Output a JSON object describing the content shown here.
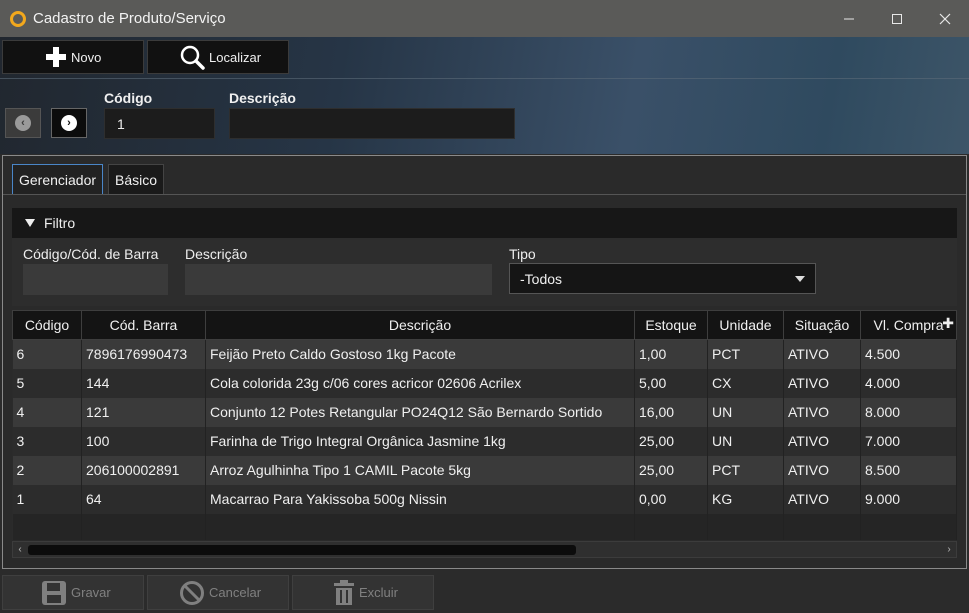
{
  "window": {
    "title": "Cadastro de Produto/Serviço",
    "minimize_icon": "minimize-icon",
    "maximize_icon": "maximize-icon",
    "close_icon": "close-icon"
  },
  "toolbar": {
    "novo_label": "Novo",
    "localizar_label": "Localizar"
  },
  "record": {
    "codigo_label": "Código",
    "codigo_value": "1",
    "descricao_label": "Descrição",
    "descricao_value": ""
  },
  "tabs": [
    {
      "label": "Gerenciador",
      "active": true
    },
    {
      "label": "Básico",
      "active": false
    }
  ],
  "filter": {
    "title": "Filtro",
    "codigo_label": "Código/Cód. de Barra",
    "codigo_value": "",
    "descricao_label": "Descrição",
    "descricao_value": "",
    "tipo_label": "Tipo",
    "tipo_selected": "-Todos"
  },
  "table": {
    "headers": [
      "Código",
      "Cód. Barra",
      "Descrição",
      "Estoque",
      "Unidade",
      "Situação",
      "Vl. Compra"
    ],
    "rows": [
      [
        "6",
        "7896176990473",
        "Feijão Preto Caldo Gostoso 1kg Pacote",
        "1,00",
        "PCT",
        "ATIVO",
        "4.500"
      ],
      [
        "5",
        "144",
        "Cola colorida 23g c/06 cores acricor 02606 Acrilex",
        "5,00",
        "CX",
        "ATIVO",
        "4.000"
      ],
      [
        "4",
        "121",
        "Conjunto 12 Potes Retangular PO24Q12 São Bernardo Sortido",
        "16,00",
        "UN",
        "ATIVO",
        "8.000"
      ],
      [
        "3",
        "100",
        "Farinha de Trigo Integral Orgânica Jasmine 1kg",
        "25,00",
        "UN",
        "ATIVO",
        "7.000"
      ],
      [
        "2",
        "206100002891",
        "Arroz Agulhinha Tipo 1 CAMIL Pacote 5kg",
        "25,00",
        "PCT",
        "ATIVO",
        "8.500"
      ],
      [
        "1",
        "64",
        "Macarrao Para Yakissoba 500g Nissin",
        "0,00",
        "KG",
        "ATIVO",
        "9.000"
      ]
    ]
  },
  "actions": {
    "gravar_label": "Gravar",
    "cancelar_label": "Cancelar",
    "excluir_label": "Excluir"
  }
}
